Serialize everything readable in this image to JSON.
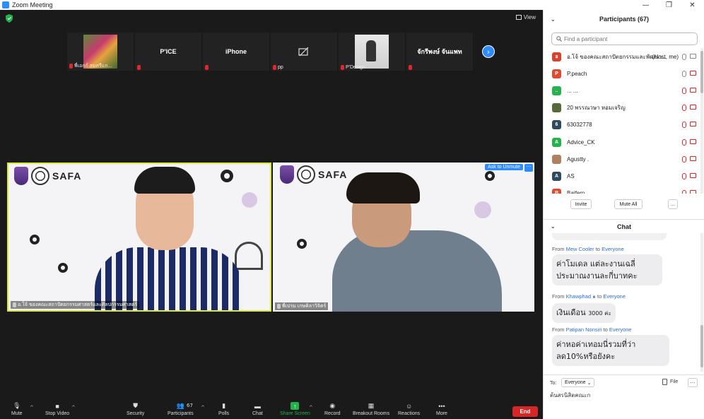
{
  "window": {
    "title": "Zoom Meeting"
  },
  "main": {
    "view_label": "View",
    "strip": [
      {
        "name": "",
        "label": "พี่เอกก์ สมศรีแก..."
      },
      {
        "name": "P'ICE",
        "label": ""
      },
      {
        "name": "iPhone",
        "label": ""
      },
      {
        "name": "",
        "label": "pp"
      },
      {
        "name": "",
        "label": "P'Design"
      },
      {
        "name": "จักรีพงษ์ จันแพท",
        "label": ""
      }
    ],
    "video_left_label": "อ.โจ้ ของคณะสถาปัตยกรรมศาสตร์และศิลปกรรมศาสตร์",
    "video_right_label": "พี่เปรม เกษคิลาวิจิตร์",
    "safa": "SAFA",
    "ask_to_unmute": "Ask to Unmute",
    "more": "···"
  },
  "toolbar": {
    "mute": "Mute",
    "stop_video": "Stop Video",
    "security": "Security",
    "participants": "Participants",
    "participants_count": "67",
    "polls": "Polls",
    "chat": "Chat",
    "share_screen": "Share Screen",
    "record": "Record",
    "breakout_rooms": "Breakout Rooms",
    "reactions": "Reactions",
    "more": "More",
    "end": "End"
  },
  "participants": {
    "title": "Participants (67)",
    "search_placeholder": "Find a participant",
    "items": [
      {
        "initial": "อ",
        "color": "#d9412c",
        "name": "อ.โจ้ ของคณะสถาปัตยกรรมและพัฒนา...",
        "tag": "(Host, me)",
        "mic_on": true,
        "cam_on": true
      },
      {
        "initial": "P",
        "color": "#e04a2f",
        "name": "P.peach",
        "tag": "",
        "mic_on": true,
        "cam_on": false
      },
      {
        "initial": "..",
        "color": "#25b34b",
        "name": "... ...",
        "tag": "",
        "mic_on": false,
        "cam_on": false
      },
      {
        "initial": "",
        "color": "#556b3a",
        "name": "20 พรรณวษา หอมเจริญ",
        "tag": "",
        "mic_on": false,
        "cam_on": false
      },
      {
        "initial": "6",
        "color": "#2f4a5e",
        "name": "63032778",
        "tag": "",
        "mic_on": false,
        "cam_on": false
      },
      {
        "initial": "A",
        "color": "#25b34b",
        "name": "Advice_CK",
        "tag": "",
        "mic_on": false,
        "cam_on": false
      },
      {
        "initial": "",
        "color": "#b08060",
        "name": "Agustty .",
        "tag": "",
        "mic_on": false,
        "cam_on": false
      },
      {
        "initial": "A",
        "color": "#2f4a5e",
        "name": "AS",
        "tag": "",
        "mic_on": false,
        "cam_on": false
      },
      {
        "initial": "B",
        "color": "#e04a2f",
        "name": "Baifern",
        "tag": "",
        "mic_on": false,
        "cam_on": false
      }
    ],
    "invite": "Invite",
    "mute_all": "Mute All",
    "more": "..."
  },
  "chat": {
    "title": "Chat",
    "messages": [
      {
        "from": "Mew Cooler",
        "to": "Everyone",
        "text": "ค่าโมเดล แต่ละงานเฉลี่ประมาณงานละกี่บาทคะ",
        "small": ""
      },
      {
        "from": "Khawphad ๑",
        "to": "Everyone",
        "text": "เงินเดือน ",
        "small": "3000 ค่ะ"
      },
      {
        "from": "Patipan Nonsiri",
        "to": "Everyone",
        "text": "ค่าหอค่าเทอมนี่รวมที่ว่าลด10%หรือยังคะ",
        "small": ""
      }
    ],
    "from_word": "From",
    "to_word": "to",
    "to_label": "To:",
    "to_value": "Everyone",
    "file": "File",
    "more": "···",
    "input_text": "ต้นสรนิสิตคณะก"
  },
  "colors": {
    "accent": "#2d8cff",
    "end": "#d72626",
    "share": "#22b14c",
    "muted": "#e02828"
  }
}
